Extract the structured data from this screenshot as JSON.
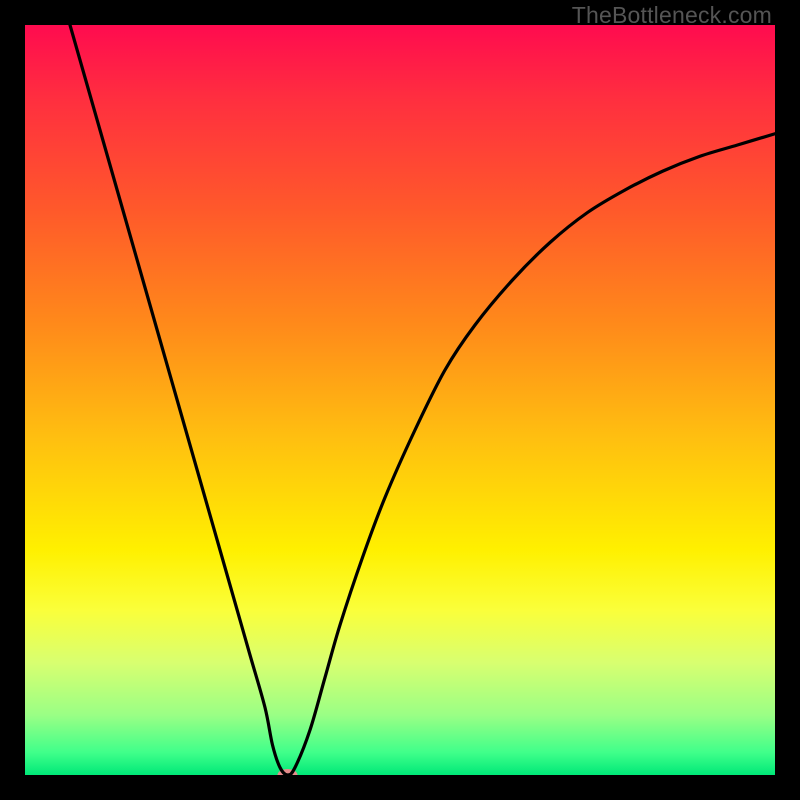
{
  "watermark": "TheBottleneck.com",
  "chart_data": {
    "type": "line",
    "title": "",
    "xlabel": "",
    "ylabel": "",
    "xlim": [
      0,
      100
    ],
    "ylim": [
      0,
      100
    ],
    "background": {
      "type": "vertical-gradient",
      "stops": [
        {
          "pos": 0.0,
          "color": "#ff0b4f"
        },
        {
          "pos": 0.1,
          "color": "#ff2f3f"
        },
        {
          "pos": 0.25,
          "color": "#ff5a2a"
        },
        {
          "pos": 0.4,
          "color": "#ff8a1a"
        },
        {
          "pos": 0.55,
          "color": "#ffbf10"
        },
        {
          "pos": 0.7,
          "color": "#fff000"
        },
        {
          "pos": 0.78,
          "color": "#faff3a"
        },
        {
          "pos": 0.85,
          "color": "#d8ff70"
        },
        {
          "pos": 0.92,
          "color": "#9aff85"
        },
        {
          "pos": 0.97,
          "color": "#40ff8a"
        },
        {
          "pos": 1.0,
          "color": "#00e878"
        }
      ]
    },
    "series": [
      {
        "name": "bottleneck-curve",
        "color": "#000000",
        "x": [
          6,
          8,
          10,
          12,
          14,
          16,
          18,
          20,
          22,
          24,
          26,
          28,
          30,
          32,
          33,
          34,
          35,
          36,
          38,
          40,
          42,
          45,
          48,
          52,
          56,
          60,
          65,
          70,
          75,
          80,
          85,
          90,
          95,
          100
        ],
        "y": [
          100,
          93,
          86,
          79,
          72,
          65,
          58,
          51,
          44,
          37,
          30,
          23,
          16,
          9,
          4,
          1,
          0,
          1,
          6,
          13,
          20,
          29,
          37,
          46,
          54,
          60,
          66,
          71,
          75,
          78,
          80.5,
          82.5,
          84,
          85.5
        ]
      }
    ],
    "marker": {
      "name": "min-point",
      "x": 35,
      "y": 0,
      "color": "#e48a8a",
      "rx": 10,
      "ry": 6
    }
  }
}
